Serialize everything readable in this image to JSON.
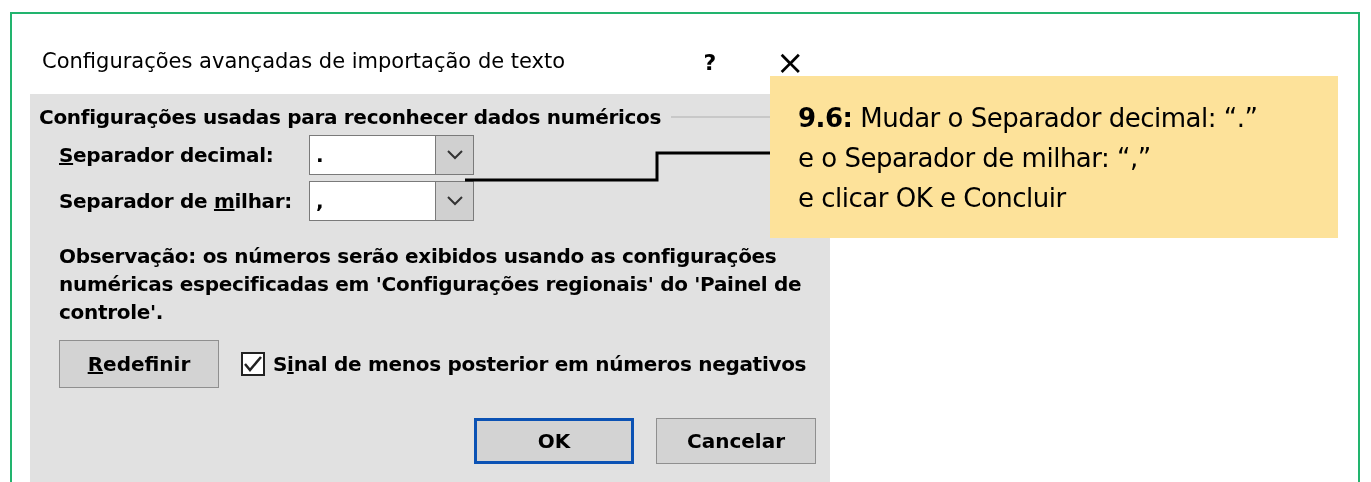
{
  "dialog": {
    "title": "Configurações avançadas de importação de texto",
    "help": "?",
    "close": "×",
    "group_title": "Configurações usadas para reconhecer dados numéricos",
    "fields": [
      {
        "label": {
          "key": "S",
          "after": "eparador decimal:"
        },
        "value": "."
      },
      {
        "label": {
          "before": "Separador de ",
          "key": "m",
          "after": "ilhar:"
        },
        "value": ","
      }
    ],
    "note": "Observação: os números serão exibidos usando as configurações numéricas especificadas em 'Configurações regionais' do 'Painel de controle'.",
    "reset_button": {
      "key": "R",
      "after": "edefinir"
    },
    "checkbox": {
      "label": {
        "before": "S",
        "key": "i",
        "after": "nal de menos posterior em números negativos"
      },
      "checked": true
    },
    "buttons": [
      {
        "label": "OK",
        "default": true
      },
      {
        "label": "Cancelar",
        "default": false
      }
    ]
  },
  "callout": {
    "lines": [
      "**9.6:** Mudar o Separador decimal: “.”",
      "e o Separador de milhar: “,”",
      "e clicar OK e Concluir"
    ]
  }
}
